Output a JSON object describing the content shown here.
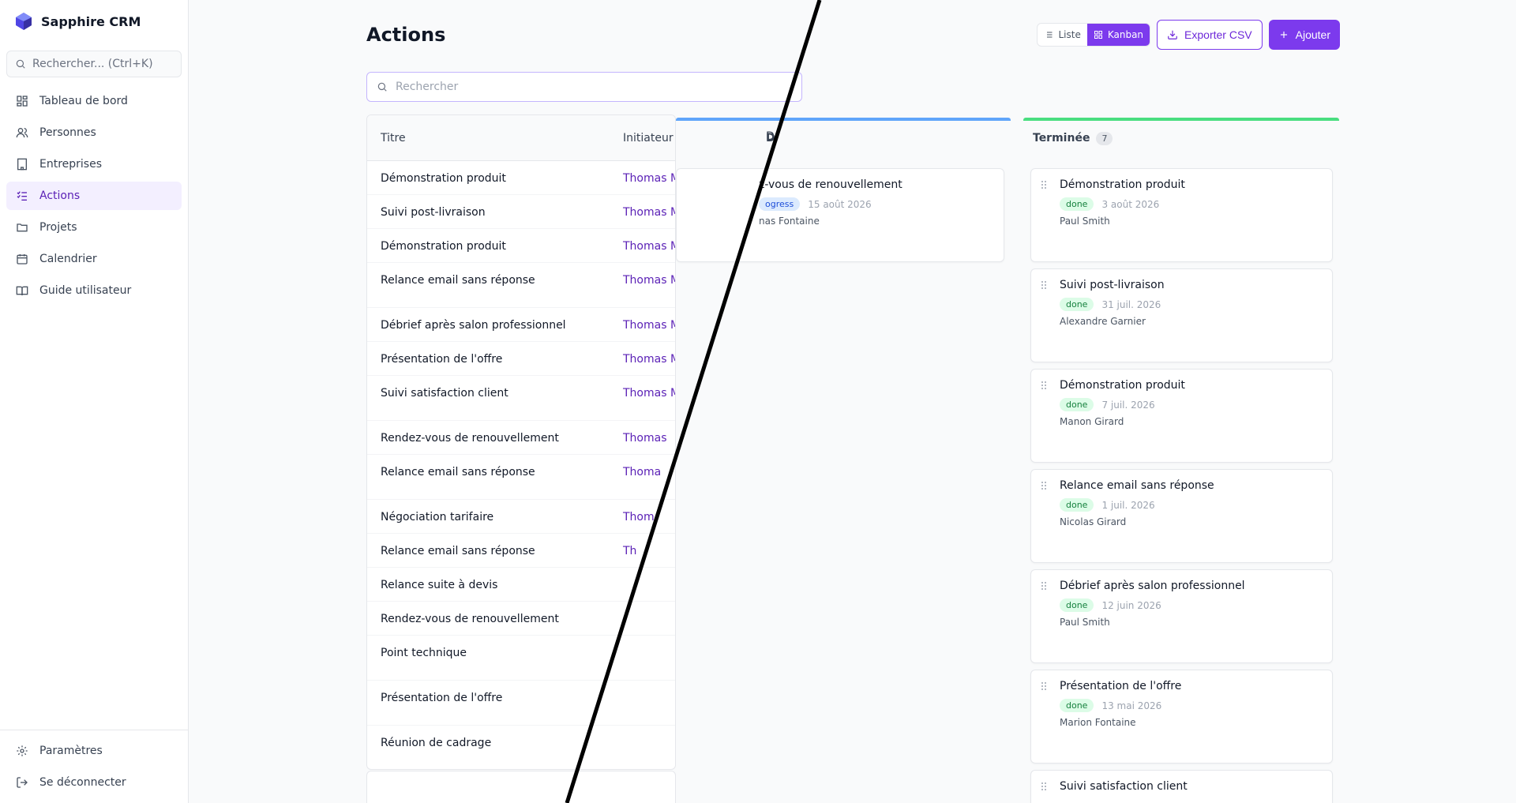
{
  "app": {
    "name": "Sapphire CRM"
  },
  "sidebar": {
    "search_placeholder": "Rechercher... (Ctrl+K)",
    "items": [
      {
        "label": "Tableau de bord",
        "icon": "dashboard-icon"
      },
      {
        "label": "Personnes",
        "icon": "users-icon"
      },
      {
        "label": "Entreprises",
        "icon": "building-icon"
      },
      {
        "label": "Actions",
        "icon": "checklist-icon",
        "active": true
      },
      {
        "label": "Projets",
        "icon": "folder-icon"
      },
      {
        "label": "Calendrier",
        "icon": "calendar-icon"
      },
      {
        "label": "Guide utilisateur",
        "icon": "book-icon"
      }
    ],
    "bottom": [
      {
        "label": "Paramètres",
        "icon": "gear-icon"
      },
      {
        "label": "Se déconnecter",
        "icon": "logout-icon"
      }
    ]
  },
  "header": {
    "title": "Actions",
    "view_list": "Liste",
    "view_kanban": "Kanban",
    "export_label": "Exporter CSV",
    "add_label": "Ajouter"
  },
  "search": {
    "placeholder": "Rechercher"
  },
  "table": {
    "headers": {
      "title": "Titre",
      "initiator": "Initiateur",
      "third": "D"
    },
    "rows": [
      {
        "title": "Démonstration produit",
        "initiator": "Thomas Mafille"
      },
      {
        "title": "Suivi post-livraison",
        "initiator": "Thomas Mafille"
      },
      {
        "title": "Démonstration produit",
        "initiator": "Thomas Mafille"
      },
      {
        "title": "Relance email sans réponse",
        "initiator": "Thomas Mafille"
      },
      {
        "title": "Débrief après salon professionnel",
        "initiator": "Thomas Mafille"
      },
      {
        "title": "Présentation de l'offre",
        "initiator": "Thomas Mafille"
      },
      {
        "title": "Suivi satisfaction client",
        "initiator": "Thomas Ma"
      },
      {
        "title": "Rendez-vous de renouvellement",
        "initiator": "Thomas"
      },
      {
        "title": "Relance email sans réponse",
        "initiator": "Thoma"
      },
      {
        "title": "Négociation tarifaire",
        "initiator": "Thom"
      },
      {
        "title": "Relance email sans réponse",
        "initiator": "Th"
      },
      {
        "title": "Relance suite à devis",
        "initiator": ""
      },
      {
        "title": "Rendez-vous de renouvellement",
        "initiator": ""
      },
      {
        "title": "Point technique",
        "initiator": ""
      },
      {
        "title": "Présentation de l'offre",
        "initiator": ""
      },
      {
        "title": "Réunion de cadrage",
        "initiator": ""
      }
    ]
  },
  "kanban": {
    "inprogress": {
      "header_fragment": "D",
      "card": {
        "title": "z-vous de renouvellement",
        "status": "ogress",
        "date": "15 août 2026",
        "owner": "nas Fontaine"
      }
    },
    "done": {
      "label": "Terminée",
      "count": "7",
      "cards": [
        {
          "title": "Démonstration produit",
          "status": "done",
          "date": "3 août 2026",
          "owner": "Paul Smith"
        },
        {
          "title": "Suivi post-livraison",
          "status": "done",
          "date": "31 juil. 2026",
          "owner": "Alexandre Garnier"
        },
        {
          "title": "Démonstration produit",
          "status": "done",
          "date": "7 juil. 2026",
          "owner": "Manon Girard"
        },
        {
          "title": "Relance email sans réponse",
          "status": "done",
          "date": "1 juil. 2026",
          "owner": "Nicolas Girard"
        },
        {
          "title": "Débrief après salon professionnel",
          "status": "done",
          "date": "12 juin 2026",
          "owner": "Paul Smith"
        },
        {
          "title": "Présentation de l'offre",
          "status": "done",
          "date": "13 mai 2026",
          "owner": "Marion Fontaine"
        },
        {
          "title": "Suivi satisfaction client",
          "status": "",
          "date": "",
          "owner": ""
        }
      ]
    }
  },
  "colors": {
    "accent": "#7c3aed",
    "progress_bar": "#60a5fa",
    "done_bar": "#4ade80"
  }
}
